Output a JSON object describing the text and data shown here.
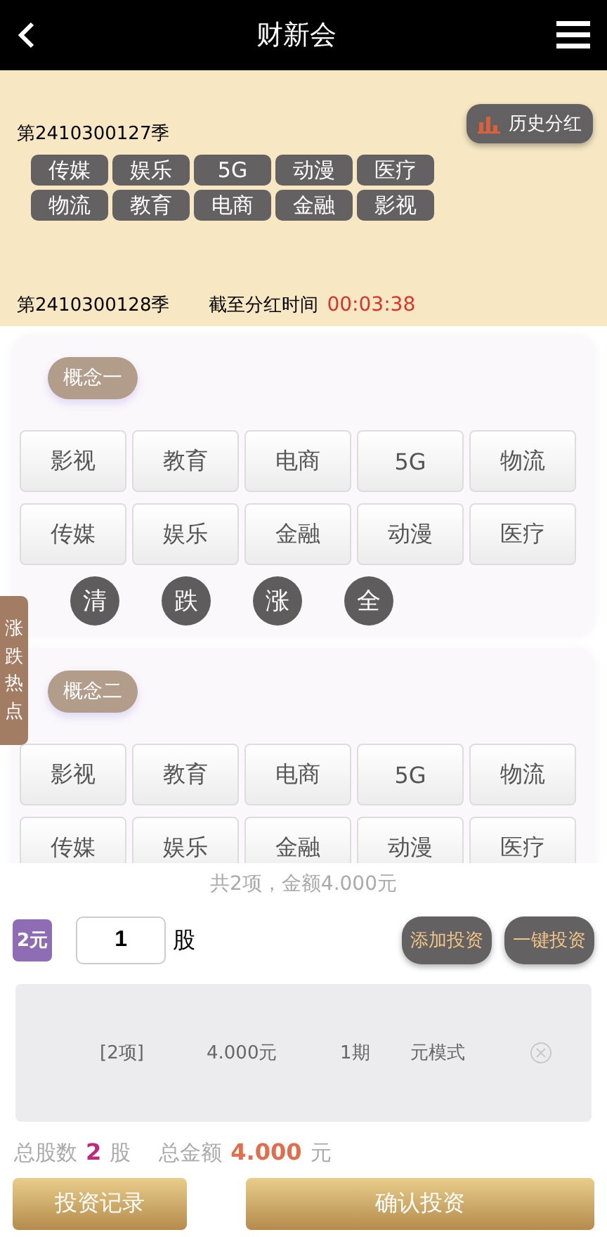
{
  "header": {
    "title": "财新会"
  },
  "current": {
    "period": "第2410300127季",
    "history_button": "历史分红",
    "tags": [
      "传媒",
      "娱乐",
      "5G",
      "动漫",
      "医疗",
      "物流",
      "教育",
      "电商",
      "金融",
      "影视"
    ]
  },
  "next": {
    "period": "第2410300128季",
    "deadline_label": "截至分红时间",
    "countdown": "00:03:38"
  },
  "side_tab": "涨跌热点",
  "concepts": [
    {
      "title": "概念一",
      "items": [
        {
          "label": "影视",
          "selected": false
        },
        {
          "label": "教育",
          "selected": false
        },
        {
          "label": "电商",
          "selected": false
        },
        {
          "label": "5G",
          "selected": false
        },
        {
          "label": "物流",
          "selected": false
        },
        {
          "label": "传媒",
          "selected": false
        },
        {
          "label": "娱乐",
          "selected": false
        },
        {
          "label": "金融",
          "selected": false
        },
        {
          "label": "动漫",
          "selected": false
        },
        {
          "label": "医疗",
          "selected": false
        }
      ],
      "filters": [
        "清",
        "跌",
        "涨",
        "全"
      ]
    },
    {
      "title": "概念二",
      "items": [
        {
          "label": "影视",
          "selected": false
        },
        {
          "label": "教育",
          "selected": false
        },
        {
          "label": "电商",
          "selected": false
        },
        {
          "label": "5G",
          "selected": false
        },
        {
          "label": "物流",
          "selected": false
        },
        {
          "label": "传媒",
          "selected": false
        },
        {
          "label": "娱乐",
          "selected": false
        },
        {
          "label": "金融",
          "selected": false
        },
        {
          "label": "动漫",
          "selected": false
        },
        {
          "label": "医疗",
          "selected": false
        }
      ]
    }
  ],
  "summary": "共2项，金额4.000元",
  "order": {
    "unit": "2元",
    "quantity": "1",
    "quantity_unit": "股",
    "add_button": "添加投资",
    "one_click_button": "一键投资"
  },
  "basket": [
    {
      "count": "[2项]",
      "amount": "4.000元",
      "periods": "1期",
      "mode": "元模式"
    }
  ],
  "totals": {
    "shares_label": "总股数",
    "shares": "2",
    "shares_unit": "股",
    "amount_label": "总金额",
    "amount": "4.000",
    "amount_unit": "元"
  },
  "footer": {
    "records_button": "投资记录",
    "confirm_button": "确认投资"
  }
}
